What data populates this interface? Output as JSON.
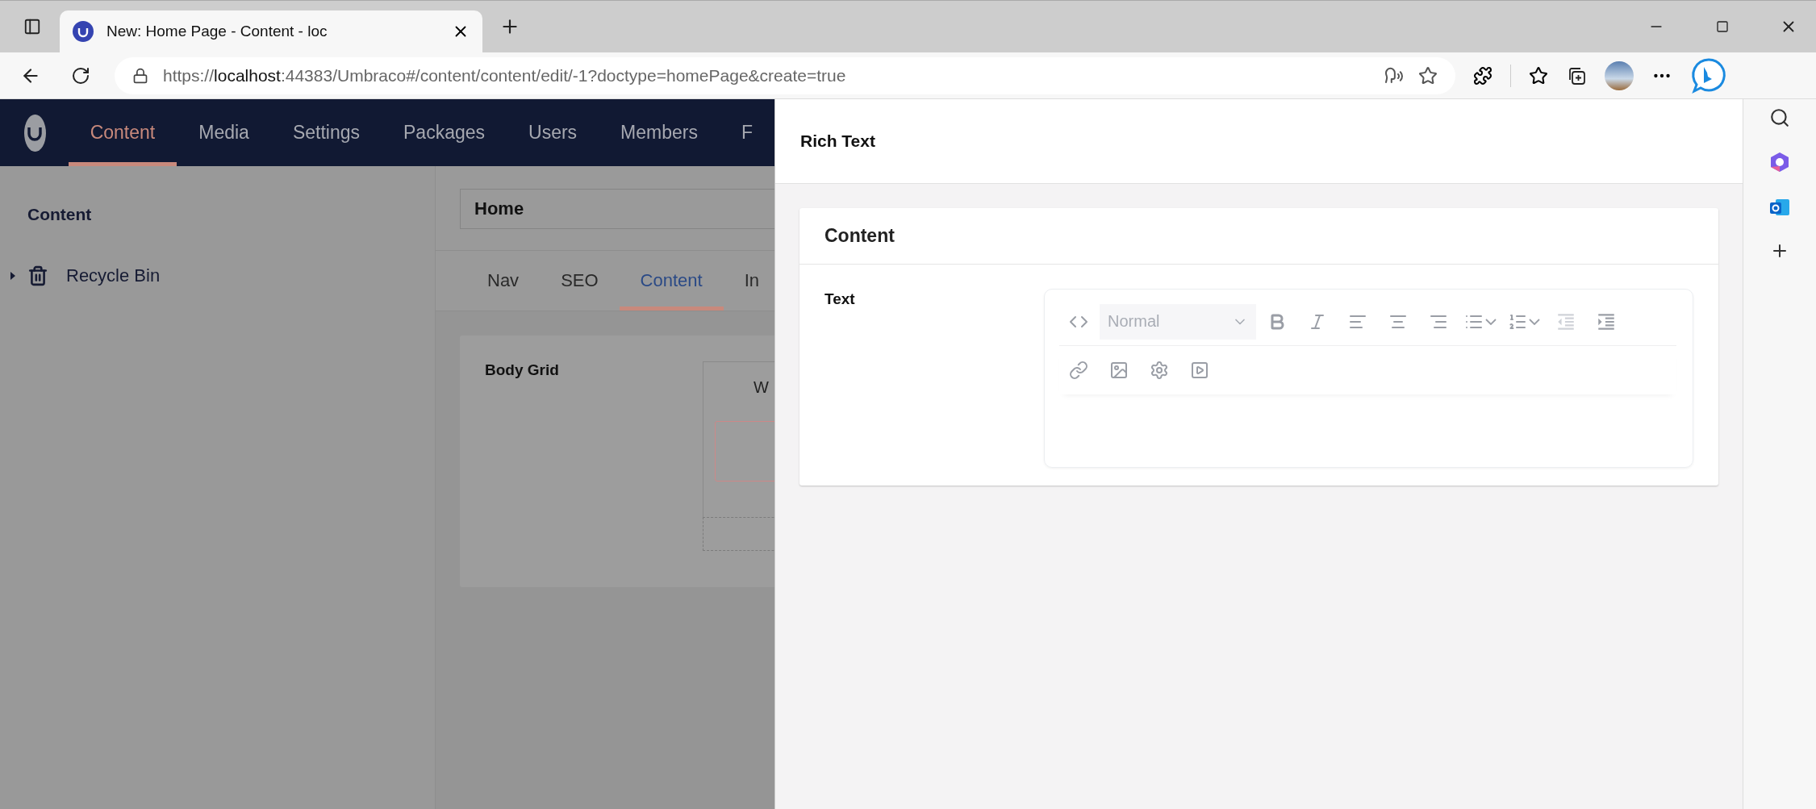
{
  "browser": {
    "tabs": [
      {
        "title": "New: Home Page - Content - loc",
        "selected": true
      }
    ],
    "address": {
      "scheme": "https://",
      "host": "localhost",
      "rest": ":44383/Umbraco#/content/content/edit/-1?doctype=homePage&create=true"
    }
  },
  "nav": [
    {
      "label": "Content",
      "selected": true
    },
    {
      "label": "Media",
      "selected": false
    },
    {
      "label": "Settings",
      "selected": false
    },
    {
      "label": "Packages",
      "selected": false
    },
    {
      "label": "Users",
      "selected": false
    },
    {
      "label": "Members",
      "selected": false
    },
    {
      "label": "F",
      "selected": false
    }
  ],
  "tree": {
    "title": "Content",
    "items": [
      {
        "label": "Recycle Bin",
        "expanded": false
      }
    ]
  },
  "editor": {
    "name": "Home",
    "tabs": [
      {
        "label": "Nav",
        "selected": false
      },
      {
        "label": "SEO",
        "selected": false
      },
      {
        "label": "Content",
        "selected": true
      },
      {
        "label": "In",
        "selected": false
      }
    ],
    "properties": [
      {
        "label": "Body Grid",
        "grid_text": "W"
      }
    ]
  },
  "panel": {
    "title": "Rich Text",
    "group": {
      "title": "Content",
      "properties": [
        {
          "label": "Text",
          "toolbar": [
            [
              {
                "kind": "code",
                "disabled": false
              },
              {
                "kind": "format",
                "placeholder": "Normal",
                "disabled": false
              },
              {
                "kind": "bold",
                "disabled": false
              },
              {
                "kind": "italic",
                "disabled": false
              },
              {
                "kind": "align-left",
                "disabled": false
              },
              {
                "kind": "align-center",
                "disabled": false
              },
              {
                "kind": "align-right",
                "disabled": false
              },
              {
                "kind": "bullets",
                "disabled": false
              },
              {
                "kind": "numbers",
                "disabled": false
              },
              {
                "kind": "outdent",
                "disabled": true
              },
              {
                "kind": "indent",
                "disabled": false
              }
            ],
            [
              {
                "kind": "link",
                "disabled": false
              },
              {
                "kind": "image",
                "disabled": false
              },
              {
                "kind": "settings",
                "disabled": false
              },
              {
                "kind": "media",
                "disabled": false
              }
            ]
          ]
        }
      ]
    }
  }
}
